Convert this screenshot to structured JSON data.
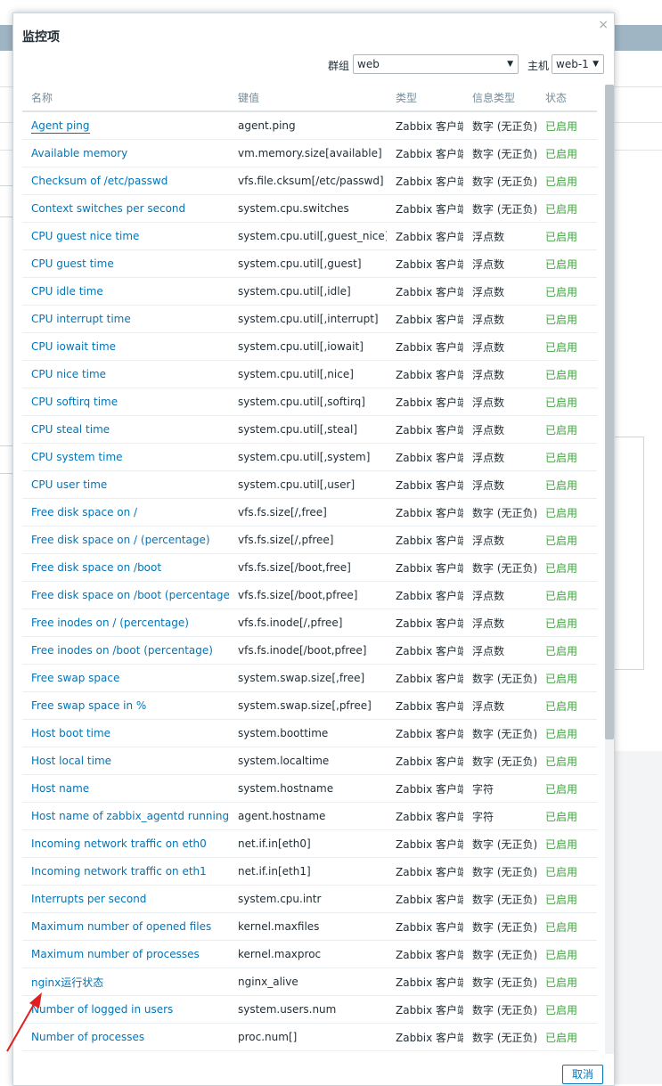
{
  "dialog": {
    "title": "监控项",
    "close": "×",
    "group_label": "群组",
    "group_value": "web",
    "host_label": "主机",
    "host_value": "web-1",
    "cancel_label": "取消"
  },
  "table": {
    "headers": [
      "名称",
      "键值",
      "类型",
      "信息类型",
      "状态"
    ],
    "rows": [
      {
        "name": "Agent ping",
        "key": "agent.ping",
        "type": "Zabbix 客户端",
        "info": "数字 (无正负)",
        "status": "已启用"
      },
      {
        "name": "Available memory",
        "key": "vm.memory.size[available]",
        "type": "Zabbix 客户端",
        "info": "数字 (无正负)",
        "status": "已启用"
      },
      {
        "name": "Checksum of /etc/passwd",
        "key": "vfs.file.cksum[/etc/passwd]",
        "type": "Zabbix 客户端",
        "info": "数字 (无正负)",
        "status": "已启用"
      },
      {
        "name": "Context switches per second",
        "key": "system.cpu.switches",
        "type": "Zabbix 客户端",
        "info": "数字 (无正负)",
        "status": "已启用"
      },
      {
        "name": "CPU guest nice time",
        "key": "system.cpu.util[,guest_nice]",
        "type": "Zabbix 客户端",
        "info": "浮点数",
        "status": "已启用"
      },
      {
        "name": "CPU guest time",
        "key": "system.cpu.util[,guest]",
        "type": "Zabbix 客户端",
        "info": "浮点数",
        "status": "已启用"
      },
      {
        "name": "CPU idle time",
        "key": "system.cpu.util[,idle]",
        "type": "Zabbix 客户端",
        "info": "浮点数",
        "status": "已启用"
      },
      {
        "name": "CPU interrupt time",
        "key": "system.cpu.util[,interrupt]",
        "type": "Zabbix 客户端",
        "info": "浮点数",
        "status": "已启用"
      },
      {
        "name": "CPU iowait time",
        "key": "system.cpu.util[,iowait]",
        "type": "Zabbix 客户端",
        "info": "浮点数",
        "status": "已启用"
      },
      {
        "name": "CPU nice time",
        "key": "system.cpu.util[,nice]",
        "type": "Zabbix 客户端",
        "info": "浮点数",
        "status": "已启用"
      },
      {
        "name": "CPU softirq time",
        "key": "system.cpu.util[,softirq]",
        "type": "Zabbix 客户端",
        "info": "浮点数",
        "status": "已启用"
      },
      {
        "name": "CPU steal time",
        "key": "system.cpu.util[,steal]",
        "type": "Zabbix 客户端",
        "info": "浮点数",
        "status": "已启用"
      },
      {
        "name": "CPU system time",
        "key": "system.cpu.util[,system]",
        "type": "Zabbix 客户端",
        "info": "浮点数",
        "status": "已启用"
      },
      {
        "name": "CPU user time",
        "key": "system.cpu.util[,user]",
        "type": "Zabbix 客户端",
        "info": "浮点数",
        "status": "已启用"
      },
      {
        "name": "Free disk space on /",
        "key": "vfs.fs.size[/,free]",
        "type": "Zabbix 客户端",
        "info": "数字 (无正负)",
        "status": "已启用"
      },
      {
        "name": "Free disk space on / (percentage)",
        "key": "vfs.fs.size[/,pfree]",
        "type": "Zabbix 客户端",
        "info": "浮点数",
        "status": "已启用"
      },
      {
        "name": "Free disk space on /boot",
        "key": "vfs.fs.size[/boot,free]",
        "type": "Zabbix 客户端",
        "info": "数字 (无正负)",
        "status": "已启用"
      },
      {
        "name": "Free disk space on /boot (percentage)",
        "key": "vfs.fs.size[/boot,pfree]",
        "type": "Zabbix 客户端",
        "info": "浮点数",
        "status": "已启用"
      },
      {
        "name": "Free inodes on / (percentage)",
        "key": "vfs.fs.inode[/,pfree]",
        "type": "Zabbix 客户端",
        "info": "浮点数",
        "status": "已启用"
      },
      {
        "name": "Free inodes on /boot (percentage)",
        "key": "vfs.fs.inode[/boot,pfree]",
        "type": "Zabbix 客户端",
        "info": "浮点数",
        "status": "已启用"
      },
      {
        "name": "Free swap space",
        "key": "system.swap.size[,free]",
        "type": "Zabbix 客户端",
        "info": "数字 (无正负)",
        "status": "已启用"
      },
      {
        "name": "Free swap space in %",
        "key": "system.swap.size[,pfree]",
        "type": "Zabbix 客户端",
        "info": "浮点数",
        "status": "已启用"
      },
      {
        "name": "Host boot time",
        "key": "system.boottime",
        "type": "Zabbix 客户端",
        "info": "数字 (无正负)",
        "status": "已启用"
      },
      {
        "name": "Host local time",
        "key": "system.localtime",
        "type": "Zabbix 客户端",
        "info": "数字 (无正负)",
        "status": "已启用"
      },
      {
        "name": "Host name",
        "key": "system.hostname",
        "type": "Zabbix 客户端",
        "info": "字符",
        "status": "已启用"
      },
      {
        "name": "Host name of zabbix_agentd running",
        "key": "agent.hostname",
        "type": "Zabbix 客户端",
        "info": "字符",
        "status": "已启用"
      },
      {
        "name": "Incoming network traffic on eth0",
        "key": "net.if.in[eth0]",
        "type": "Zabbix 客户端",
        "info": "数字 (无正负)",
        "status": "已启用"
      },
      {
        "name": "Incoming network traffic on eth1",
        "key": "net.if.in[eth1]",
        "type": "Zabbix 客户端",
        "info": "数字 (无正负)",
        "status": "已启用"
      },
      {
        "name": "Interrupts per second",
        "key": "system.cpu.intr",
        "type": "Zabbix 客户端",
        "info": "数字 (无正负)",
        "status": "已启用"
      },
      {
        "name": "Maximum number of opened files",
        "key": "kernel.maxfiles",
        "type": "Zabbix 客户端",
        "info": "数字 (无正负)",
        "status": "已启用"
      },
      {
        "name": "Maximum number of processes",
        "key": "kernel.maxproc",
        "type": "Zabbix 客户端",
        "info": "数字 (无正负)",
        "status": "已启用"
      },
      {
        "name": "nginx运行状态",
        "key": "nginx_alive",
        "type": "Zabbix 客户端",
        "info": "数字 (无正负)",
        "status": "已启用"
      },
      {
        "name": "Number of logged in users",
        "key": "system.users.num",
        "type": "Zabbix 客户端",
        "info": "数字 (无正负)",
        "status": "已启用"
      },
      {
        "name": "Number of processes",
        "key": "proc.num[]",
        "type": "Zabbix 客户端",
        "info": "数字 (无正负)",
        "status": "已启用"
      }
    ]
  },
  "colors": {
    "link": "#0275b8",
    "enabled": "#3fa33f",
    "header_text": "#768d99",
    "annotation_arrow": "#e02020"
  }
}
